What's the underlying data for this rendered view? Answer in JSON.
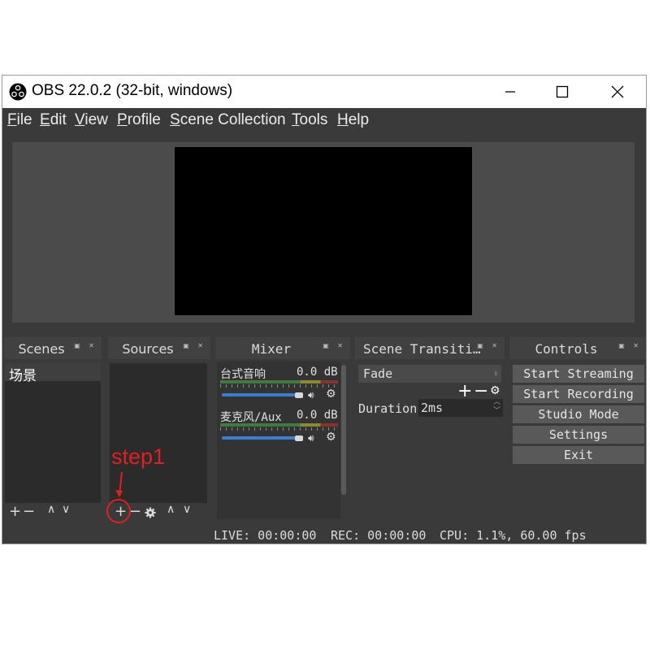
{
  "window": {
    "title": "OBS 22.0.2 (32-bit, windows)"
  },
  "menu": [
    "File",
    "Edit",
    "View",
    "Profile",
    "Scene Collection",
    "Tools",
    "Help"
  ],
  "docks": {
    "scenes": {
      "title": "Scenes",
      "items": [
        "场景"
      ],
      "add": "+",
      "remove": "−",
      "up": "∧",
      "down": "∨"
    },
    "sources": {
      "title": "Sources",
      "add": "+",
      "remove": "−",
      "up": "∧",
      "down": "∨"
    },
    "mixer": {
      "title": "Mixer",
      "channels": [
        {
          "name": "台式音响",
          "db": "0.0 dB"
        },
        {
          "name": "麦克风/Aux",
          "db": "0.0 dB"
        }
      ]
    },
    "transitions": {
      "title": "Scene Transiti…",
      "selected": "Fade",
      "duration_label": "Duration",
      "duration_value": "2ms"
    },
    "controls": {
      "title": "Controls",
      "buttons": [
        "Start Streaming",
        "Start Recording",
        "Studio Mode",
        "Settings",
        "Exit"
      ]
    }
  },
  "status": {
    "live": "LIVE: 00:00:00",
    "rec": "REC: 00:00:00",
    "cpu": "CPU: 1.1%, 60.00 fps"
  },
  "annotation": {
    "text": "step1",
    "color": "#e02020"
  }
}
